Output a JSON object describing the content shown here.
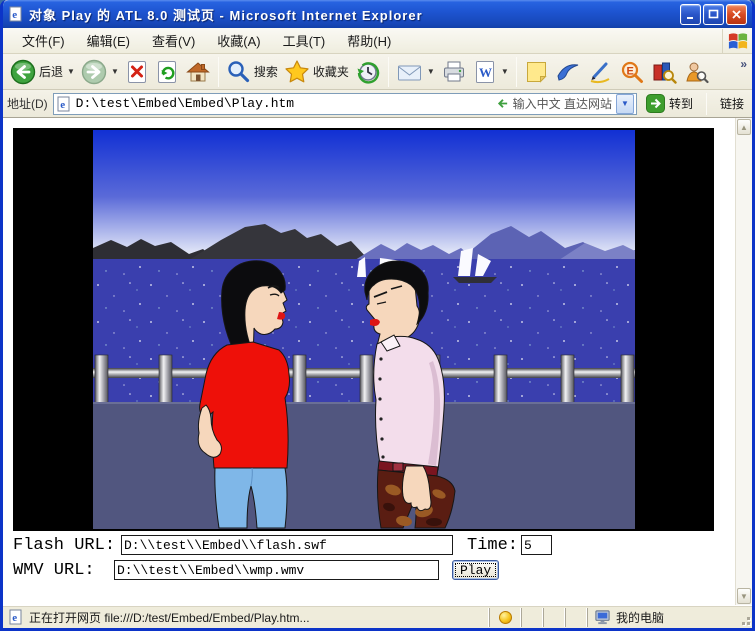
{
  "window": {
    "title": "对象 Play 的 ATL 8.0 测试页 - Microsoft Internet Explorer"
  },
  "menu": {
    "items": [
      "文件(F)",
      "编辑(E)",
      "查看(V)",
      "收藏(A)",
      "工具(T)",
      "帮助(H)"
    ]
  },
  "toolbar": {
    "back_label": "后退",
    "search_label": "搜索",
    "favorites_label": "收藏夹",
    "overflow_label": "»"
  },
  "addressbar": {
    "label": "地址(D)",
    "value": "D:\\test\\Embed\\Embed\\Play.htm",
    "ime_hint": "输入中文 直达网站",
    "go_label": "转到",
    "links_label": "链接"
  },
  "form": {
    "flash_label": "Flash URL:",
    "flash_value": "D:\\\\test\\\\Embed\\\\flash.swf",
    "time_label": "Time:",
    "time_value": "5",
    "wmv_label": "WMV URL:",
    "wmv_value": "D:\\\\test\\\\Embed\\\\wmp.wmv",
    "play_label": "Play"
  },
  "statusbar": {
    "loading_text": "正在打开网页 file:///D:/test/Embed/Embed/Play.htm...",
    "zone_label": "我的电脑"
  },
  "colors": {
    "titlebar_blue": "#1E55D2",
    "chrome_beige": "#F1EEE2",
    "field_border": "#7F9DB9",
    "sky_top": "#1130D4",
    "sea_blue": "#3A3FAE",
    "promenade": "#51567F",
    "mountain_dark": "#35353B",
    "mountain_purple": "#5C63B4",
    "tee_red": "#EE1009",
    "jeans_blue": "#7FB7E8",
    "shirt_pink": "#F3DDEB",
    "pants_maroon": "#5A1D12"
  }
}
